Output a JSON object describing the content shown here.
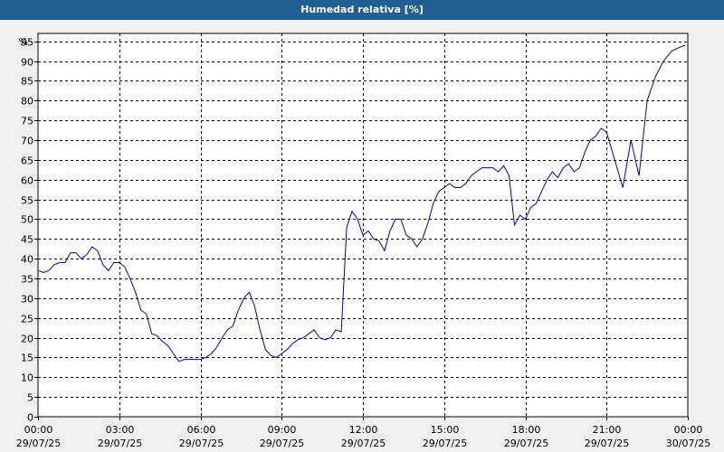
{
  "window": {
    "title": "Humedad relativa [%]"
  },
  "colors": {
    "titlebar": "#1f5f91",
    "line": "#0000aa",
    "background": "#f0f0f0",
    "plot_area": "#ffffff"
  },
  "chart_data": {
    "type": "line",
    "title": "Humedad relativa [%]",
    "ylabel": "%",
    "xlabel": "",
    "ylim": [
      0,
      97
    ],
    "yticks": [
      0,
      5,
      10,
      15,
      20,
      25,
      30,
      35,
      40,
      45,
      50,
      55,
      60,
      65,
      70,
      75,
      80,
      85,
      90,
      95
    ],
    "grid": true,
    "xticks": [
      {
        "time": "00:00",
        "date": "29/07/25"
      },
      {
        "time": "03:00",
        "date": "29/07/25"
      },
      {
        "time": "06:00",
        "date": "29/07/25"
      },
      {
        "time": "09:00",
        "date": "29/07/25"
      },
      {
        "time": "12:00",
        "date": "29/07/25"
      },
      {
        "time": "15:00",
        "date": "29/07/25"
      },
      {
        "time": "18:00",
        "date": "29/07/25"
      },
      {
        "time": "21:00",
        "date": "29/07/25"
      },
      {
        "time": "00:00",
        "date": "30/07/25"
      }
    ],
    "x_hours": [
      0,
      0.2,
      0.4,
      0.6,
      0.8,
      1.0,
      1.2,
      1.4,
      1.6,
      1.8,
      2.0,
      2.2,
      2.4,
      2.6,
      2.8,
      3.0,
      3.2,
      3.4,
      3.6,
      3.8,
      4.0,
      4.2,
      4.4,
      4.6,
      4.8,
      5.0,
      5.2,
      5.4,
      5.6,
      5.8,
      6.0,
      6.2,
      6.4,
      6.6,
      6.8,
      7.0,
      7.2,
      7.4,
      7.6,
      7.8,
      8.0,
      8.2,
      8.4,
      8.6,
      8.8,
      9.0,
      9.2,
      9.4,
      9.6,
      9.8,
      10.0,
      10.2,
      10.4,
      10.6,
      10.8,
      11.0,
      11.2,
      11.4,
      11.6,
      11.8,
      12.0,
      12.2,
      12.4,
      12.6,
      12.8,
      13.0,
      13.2,
      13.4,
      13.6,
      13.8,
      14.0,
      14.2,
      14.4,
      14.6,
      14.8,
      15.0,
      15.2,
      15.4,
      15.6,
      15.8,
      16.0,
      16.2,
      16.4,
      16.6,
      16.8,
      17.0,
      17.2,
      17.4,
      17.6,
      17.8,
      18.0,
      18.2,
      18.4,
      18.6,
      18.8,
      19.0,
      19.2,
      19.4,
      19.6,
      19.8,
      20.0,
      20.2,
      20.4,
      20.6,
      20.8,
      21.0,
      21.3,
      21.6,
      21.9,
      22.2,
      22.5,
      22.8,
      23.1,
      23.4,
      23.7,
      23.9
    ],
    "series": [
      {
        "values": [
          37,
          36.5,
          37,
          38.5,
          39,
          39,
          41.5,
          41.5,
          40,
          41,
          43,
          42,
          38.5,
          37,
          39,
          39,
          38,
          35,
          31.5,
          27,
          26,
          21,
          20.5,
          19,
          18,
          16,
          14,
          14.5,
          14.5,
          14.5,
          14.5,
          15,
          16,
          17.5,
          20,
          22,
          23,
          27,
          30,
          31.5,
          28,
          22,
          17,
          15.5,
          15,
          16,
          17,
          18.5,
          19.5,
          20,
          21,
          22,
          20,
          19.5,
          20,
          22,
          21.5,
          48,
          52,
          50,
          46,
          47,
          45,
          44.5,
          42,
          47,
          50,
          50,
          46,
          45,
          43,
          45,
          49,
          54,
          57,
          58,
          59,
          58,
          58,
          59,
          61,
          62,
          63,
          63,
          63,
          62,
          63.5,
          61,
          48.5,
          51,
          50,
          53,
          54,
          57,
          60,
          62,
          60.5,
          63,
          64,
          62,
          63,
          67,
          70,
          71,
          73,
          72,
          65,
          58,
          70,
          61,
          80,
          86,
          90,
          92.5,
          93.5,
          94,
          94,
          94,
          94.5,
          94.5,
          94.5,
          94.5,
          94.5
        ]
      }
    ]
  }
}
